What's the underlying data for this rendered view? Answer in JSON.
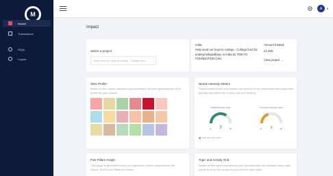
{
  "sidebar": {
    "logo_letter": "M",
    "items": [
      {
        "label": "Impact",
        "active": true
      },
      {
        "label": "Transactions",
        "active": false
      },
      {
        "label": "FAQs",
        "active": false
      },
      {
        "label": "Logout",
        "active": false
      }
    ]
  },
  "topbar": {
    "avatar_initial": "A"
  },
  "page": {
    "title": "Impact"
  },
  "select_project": {
    "label": "Select a project",
    "value": "Help send our boys to college - College fund"
  },
  "project": {
    "country": "India",
    "description": "Help send our boys to college - College fund for underprivilegedboys in India by TEIKYO FOUNDATION (UK)",
    "amount_label": "Amount funded:",
    "amount_value": "£1,000",
    "view_label": "View project →"
  },
  "sdg_profile": {
    "title": "SDG Profile:",
    "text": "Based on the impact indicators you submitted, we have generated an SDG profile for your project.",
    "tile_colors": [
      "#f4a7a3",
      "#e8d6a0",
      "#a9d3a6",
      "#e58a8f",
      "#c5142b",
      "#f7c6bf",
      "#a9dfef",
      "#f7dca0",
      "#e6b0b6",
      "#f9c2a3",
      "#e7b38c",
      "#f3c9a7",
      "#e8dca0",
      "#d9b9a0",
      "#b5dcbc",
      "#b3e0a4",
      "#b4c6e3",
      "#c4b8e0"
    ]
  },
  "intensity": {
    "title": "Needs Intensity Meters",
    "text": "These meters show how intense the need is for an intervention like yours both globally and within the country you are working.",
    "global": {
      "label": "Global intensity meter",
      "value": "7",
      "min": "0",
      "max": "10",
      "color": "#2e8b7a"
    },
    "country": {
      "label": "In-country intensity meter",
      "value": "4",
      "min": "0",
      "max": "10",
      "color": "#e89a2e"
    },
    "how_link": "How does this work?"
  },
  "five_pillars": {
    "title": "Five Pillars Graph:",
    "text": "This graph is generated using our algorithms, which compute how the Topics, SDGs and Pillars are linked."
  },
  "topic_grid": {
    "title": "Topic and Activity Grid",
    "text": "Based on the topics and actions you have selected, we estimate these data points to show the scope of your work for each topic."
  }
}
